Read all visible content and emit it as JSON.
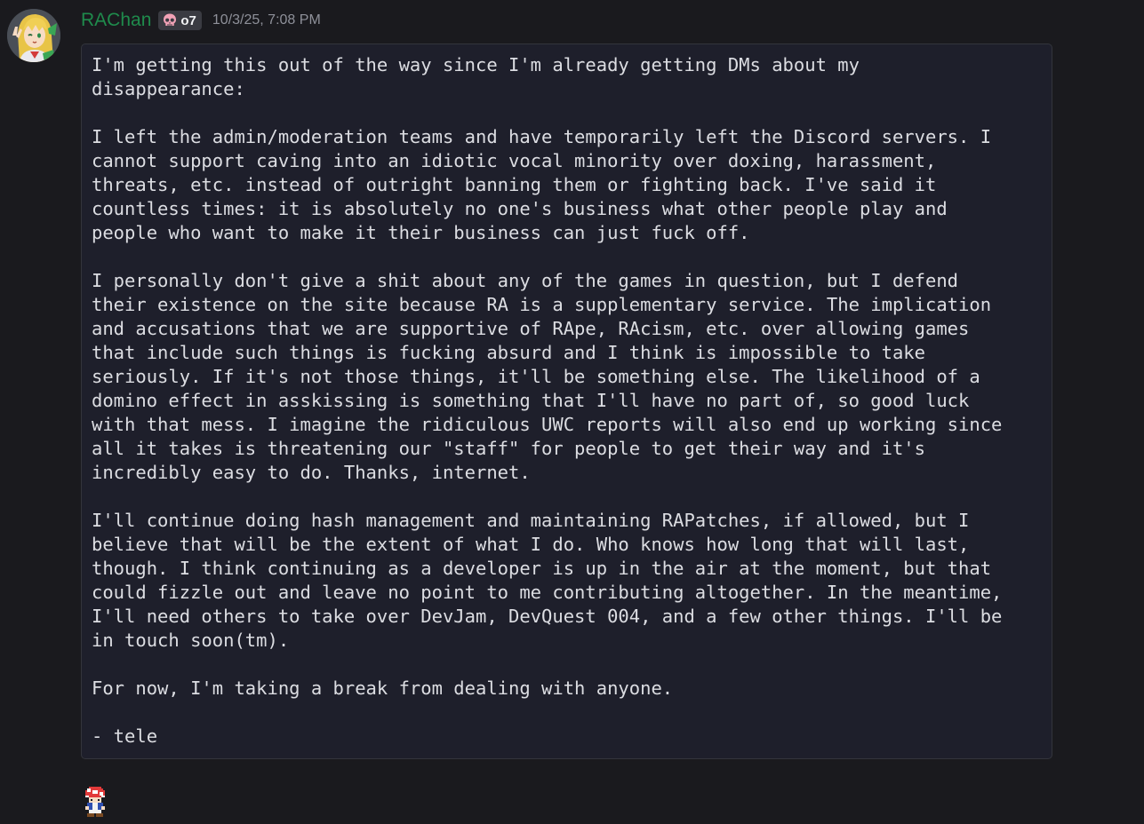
{
  "message": {
    "avatar_icon": "anime-avatar-icon",
    "username": "RAChan",
    "username_color": "#1f8b4c",
    "role_tag": {
      "icon": "skull-icon",
      "text": "o7"
    },
    "timestamp": "10/3/25, 7:08 PM",
    "code_text": "I'm getting this out of the way since I'm already getting DMs about my\ndisappearance:\n\nI left the admin/moderation teams and have temporarily left the Discord servers. I\ncannot support caving into an idiotic vocal minority over doxing, harassment,\nthreats, etc. instead of outright banning them or fighting back. I've said it\ncountless times: it is absolutely no one's business what other people play and\npeople who want to make it their business can just fuck off.\n\nI personally don't give a shit about any of the games in question, but I defend\ntheir existence on the site because RA is a supplementary service. The implication\nand accusations that we are supportive of RApe, RAcism, etc. over allowing games\nthat include such things is fucking absurd and I think is impossible to take\nseriously. If it's not those things, it'll be something else. The likelihood of a\ndomino effect in asskissing is something that I'll have no part of, so good luck\nwith that mess. I imagine the ridiculous UWC reports will also end up working since\nall it takes is threatening our \"staff\" for people to get their way and it's\nincredibly easy to do. Thanks, internet.\n\nI'll continue doing hash management and maintaining RAPatches, if allowed, but I\nbelieve that will be the extent of what I do. Who knows how long that will last,\nthough. I think continuing as a developer is up in the air at the moment, but that\ncould fizzle out and leave no point to me contributing altogether. In the meantime,\nI'll need others to take over DevJam, DevQuest 004, and a few other things. I'll be\nin touch soon(tm).\n\nFor now, I'm taking a break from dealing with anyone.\n\n- tele"
  },
  "next_message": {
    "icon": "toad-sprite-icon"
  }
}
